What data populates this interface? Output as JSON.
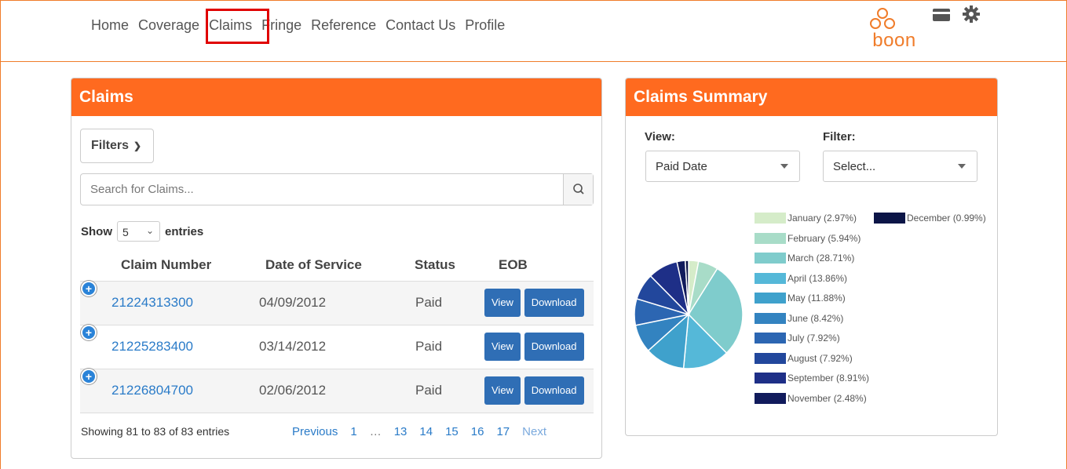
{
  "nav": {
    "items": [
      "Home",
      "Coverage",
      "Claims",
      "Fringe",
      "Reference",
      "Contact Us",
      "Profile"
    ],
    "logo_text": "boon",
    "accent": "#f07c2a"
  },
  "claims": {
    "title": "Claims",
    "filters_label": "Filters",
    "search_placeholder": "Search for Claims...",
    "show_label": "Show",
    "entries_value": "5",
    "entries_label": "entries",
    "columns": [
      "Claim Number",
      "Date of Service",
      "Status",
      "EOB"
    ],
    "rows": [
      {
        "claim": "21224313300",
        "date": "04/09/2012",
        "status": "Paid",
        "view": "View",
        "download": "Download"
      },
      {
        "claim": "21225283400",
        "date": "03/14/2012",
        "status": "Paid",
        "view": "View",
        "download": "Download"
      },
      {
        "claim": "21226804700",
        "date": "02/06/2012",
        "status": "Paid",
        "view": "View",
        "download": "Download"
      }
    ],
    "showing": "Showing 81 to 83 of 83 entries",
    "pager": [
      "Previous",
      "1",
      "…",
      "13",
      "14",
      "15",
      "16",
      "17",
      "Next"
    ]
  },
  "summary": {
    "title": "Claims Summary",
    "view_label": "View:",
    "view_value": "Paid Date",
    "filter_label": "Filter:",
    "filter_value": "Select...",
    "legend_left": [
      {
        "label": "January (2.97%)",
        "color": "#d5ecc9"
      },
      {
        "label": "February (5.94%)",
        "color": "#a8dcc8"
      },
      {
        "label": "March (28.71%)",
        "color": "#7fcccc"
      },
      {
        "label": "April (13.86%)",
        "color": "#55b8d8"
      },
      {
        "label": "May (11.88%)",
        "color": "#3fa1cc"
      },
      {
        "label": "June (8.42%)",
        "color": "#3383c0"
      },
      {
        "label": "July (7.92%)",
        "color": "#2c66b2"
      },
      {
        "label": "August (7.92%)",
        "color": "#22479c"
      },
      {
        "label": "September (8.91%)",
        "color": "#1e2f87"
      },
      {
        "label": "November (2.48%)",
        "color": "#111b5c"
      }
    ],
    "legend_right": [
      {
        "label": "December (0.99%)",
        "color": "#0c1547"
      }
    ]
  },
  "chart_data": {
    "type": "pie",
    "categories": [
      "January",
      "February",
      "March",
      "April",
      "May",
      "June",
      "July",
      "August",
      "September",
      "November",
      "December"
    ],
    "values": [
      2.97,
      5.94,
      28.71,
      13.86,
      11.88,
      8.42,
      7.92,
      7.92,
      8.91,
      2.48,
      0.99
    ],
    "colors": [
      "#d5ecc9",
      "#a8dcc8",
      "#7fcccc",
      "#55b8d8",
      "#3fa1cc",
      "#3383c0",
      "#2c66b2",
      "#22479c",
      "#1e2f87",
      "#111b5c",
      "#0c1547"
    ],
    "legend": "right"
  }
}
